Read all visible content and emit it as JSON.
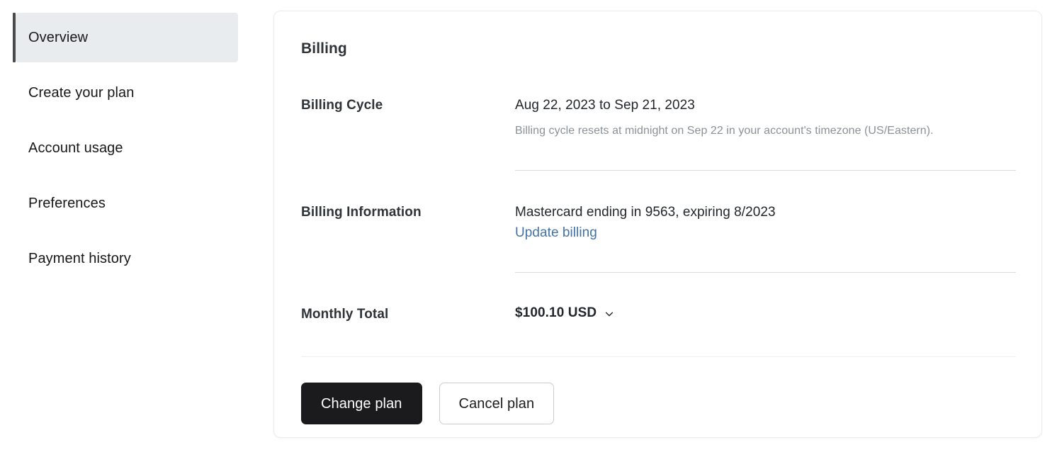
{
  "sidebar": {
    "items": [
      {
        "label": "Overview",
        "active": true
      },
      {
        "label": "Create your plan",
        "active": false
      },
      {
        "label": "Account usage",
        "active": false
      },
      {
        "label": "Preferences",
        "active": false
      },
      {
        "label": "Payment history",
        "active": false
      }
    ]
  },
  "card": {
    "title": "Billing",
    "rows": {
      "billing_cycle": {
        "label": "Billing Cycle",
        "value": "Aug 22, 2023 to Sep 21, 2023",
        "help": "Billing cycle resets at midnight on Sep 22 in your account's timezone (US/Eastern)."
      },
      "billing_information": {
        "label": "Billing Information",
        "value": "Mastercard ending in 9563, expiring 8/2023",
        "link_label": "Update billing"
      },
      "monthly_total": {
        "label": "Monthly Total",
        "value": "$100.10 USD",
        "expand_icon": "chevron-down-icon"
      }
    },
    "actions": {
      "primary_label": "Change plan",
      "secondary_label": "Cancel plan"
    }
  },
  "colors": {
    "accent_link": "#4272a8",
    "active_nav_background": "#e8ecef",
    "active_nav_bar": "#4a4a4a",
    "primary_button_background": "#1b1b1d",
    "heading_text": "#2e3338",
    "muted_text": "#8b9197"
  }
}
